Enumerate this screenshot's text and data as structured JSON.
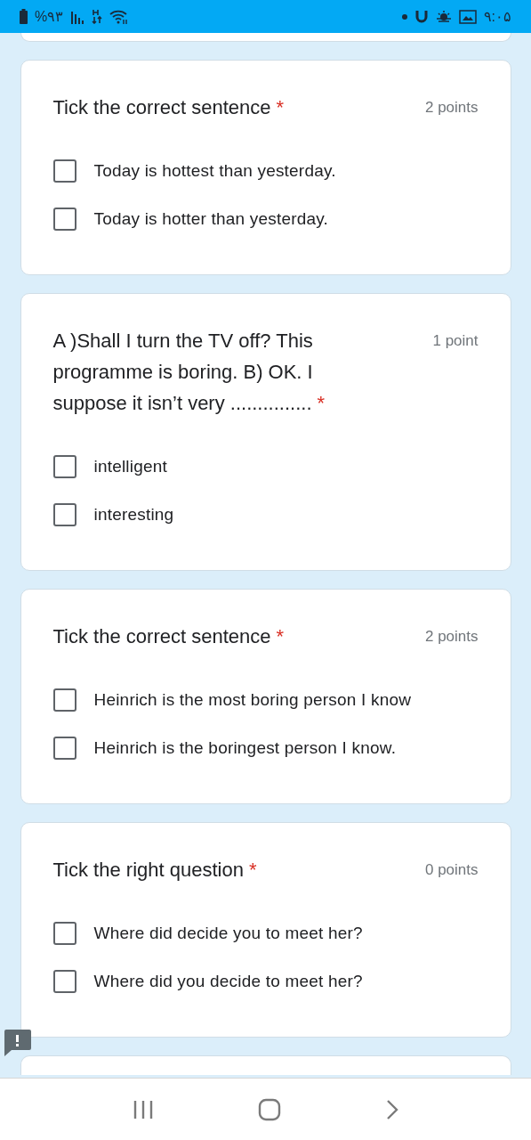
{
  "status_bar": {
    "battery": "%۹۳",
    "time": "۹:۰۵"
  },
  "questions": [
    {
      "title": "Tick the correct sentence",
      "required_mark": "*",
      "points": "2 points",
      "options": [
        {
          "label": "Today is hottest than yesterday.",
          "checked": false
        },
        {
          "label": "Today is hotter than yesterday.",
          "checked": false
        }
      ]
    },
    {
      "title": "A )Shall I turn the TV off? This programme is boring. B) OK. I suppose it isn’t very ...............",
      "required_mark": "*",
      "points": "1 point",
      "options": [
        {
          "label": "intelligent",
          "checked": false
        },
        {
          "label": "interesting",
          "checked": false
        }
      ]
    },
    {
      "title": "Tick the correct sentence",
      "required_mark": "*",
      "points": "2 points",
      "options": [
        {
          "label": "Heinrich is the most boring person I know",
          "checked": false
        },
        {
          "label": "Heinrich is the boringest person I know.",
          "checked": false
        }
      ]
    },
    {
      "title": "Tick the right question",
      "required_mark": "*",
      "points": "0 points",
      "options": [
        {
          "label": "Where did decide you to meet her?",
          "checked": false
        },
        {
          "label": "Where did you decide to meet her?",
          "checked": false
        }
      ]
    }
  ]
}
